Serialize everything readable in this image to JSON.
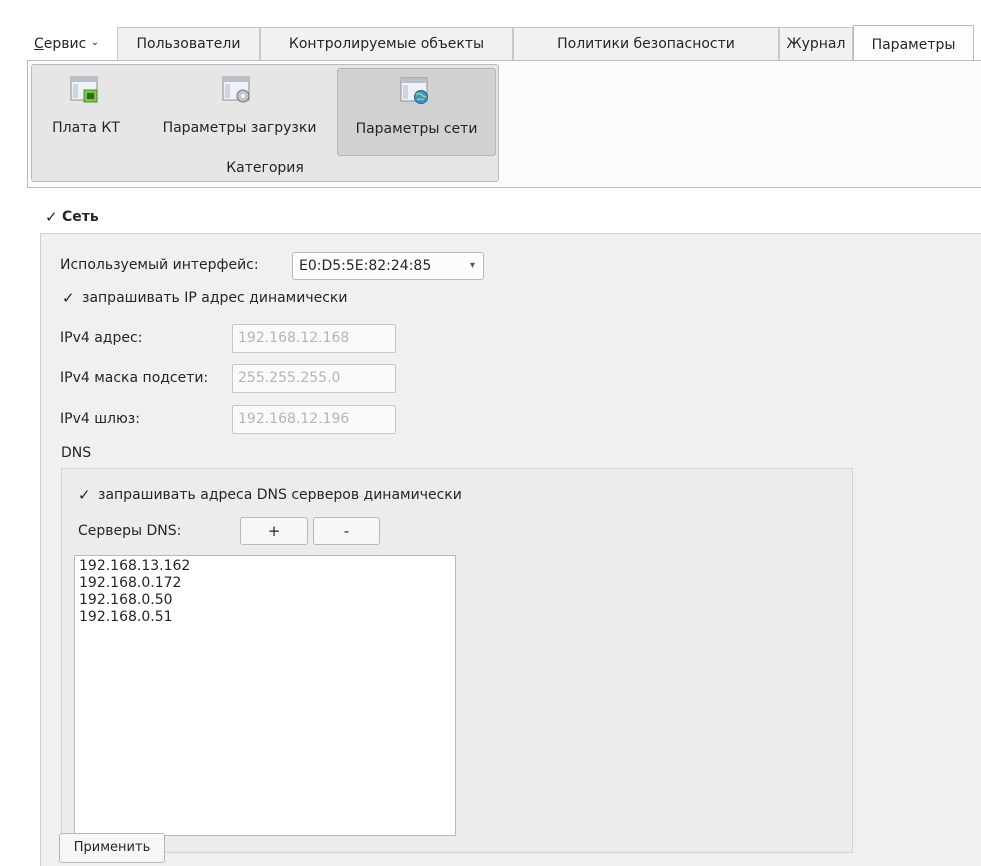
{
  "tabs": {
    "service_label": "Сервис",
    "service_accel": "С",
    "service_rest": "ервис",
    "service_arrow": "⌄",
    "items": [
      {
        "label": "Пользователи"
      },
      {
        "label": "Контролируемые объекты"
      },
      {
        "label": "Политики безопасности"
      },
      {
        "label": "Журнал"
      },
      {
        "label": "Параметры",
        "active": true
      }
    ]
  },
  "ribbon": {
    "buttons": [
      {
        "label": "Плата КТ",
        "icon": "board-window-icon"
      },
      {
        "label": "Параметры загрузки",
        "icon": "boot-settings-window-icon"
      },
      {
        "label": "Параметры сети",
        "icon": "network-window-icon",
        "selected": true
      }
    ],
    "group_caption": "Категория"
  },
  "network": {
    "section_title": "Сеть",
    "section_checked": true,
    "interface_label": "Используемый интерфейс:",
    "interface_value": "E0:D5:5E:82:24:85",
    "dhcp_ip_label": "запрашивать IP адрес динамически",
    "dhcp_ip_checked": true,
    "ipv4_address_label": "IPv4 адрес:",
    "ipv4_address_value": "192.168.12.168",
    "ipv4_mask_label": "IPv4 маска подсети:",
    "ipv4_mask_value": "255.255.255.0",
    "ipv4_gateway_label": "IPv4 шлюз:",
    "ipv4_gateway_value": "192.168.12.196",
    "dns_label": "DNS",
    "dns": {
      "dhcp_dns_label": "запрашивать адреса DNS серверов динамически",
      "dhcp_dns_checked": true,
      "servers_label": "Серверы DNS:",
      "add_label": "+",
      "remove_label": "-",
      "servers": [
        "192.168.13.162",
        "192.168.0.172",
        "192.168.0.50",
        "192.168.0.51"
      ]
    },
    "apply_label": "Применить"
  },
  "check_glyph": "✓",
  "combo_arrow": "▾",
  "colors": {
    "window_bg": "#ffffff",
    "panel_bg": "#f0f0f0",
    "ribbon_group_bg": "#e6e6e6",
    "selected_button_bg": "#d1d1d1",
    "disabled_text": "#b3b5b7"
  }
}
